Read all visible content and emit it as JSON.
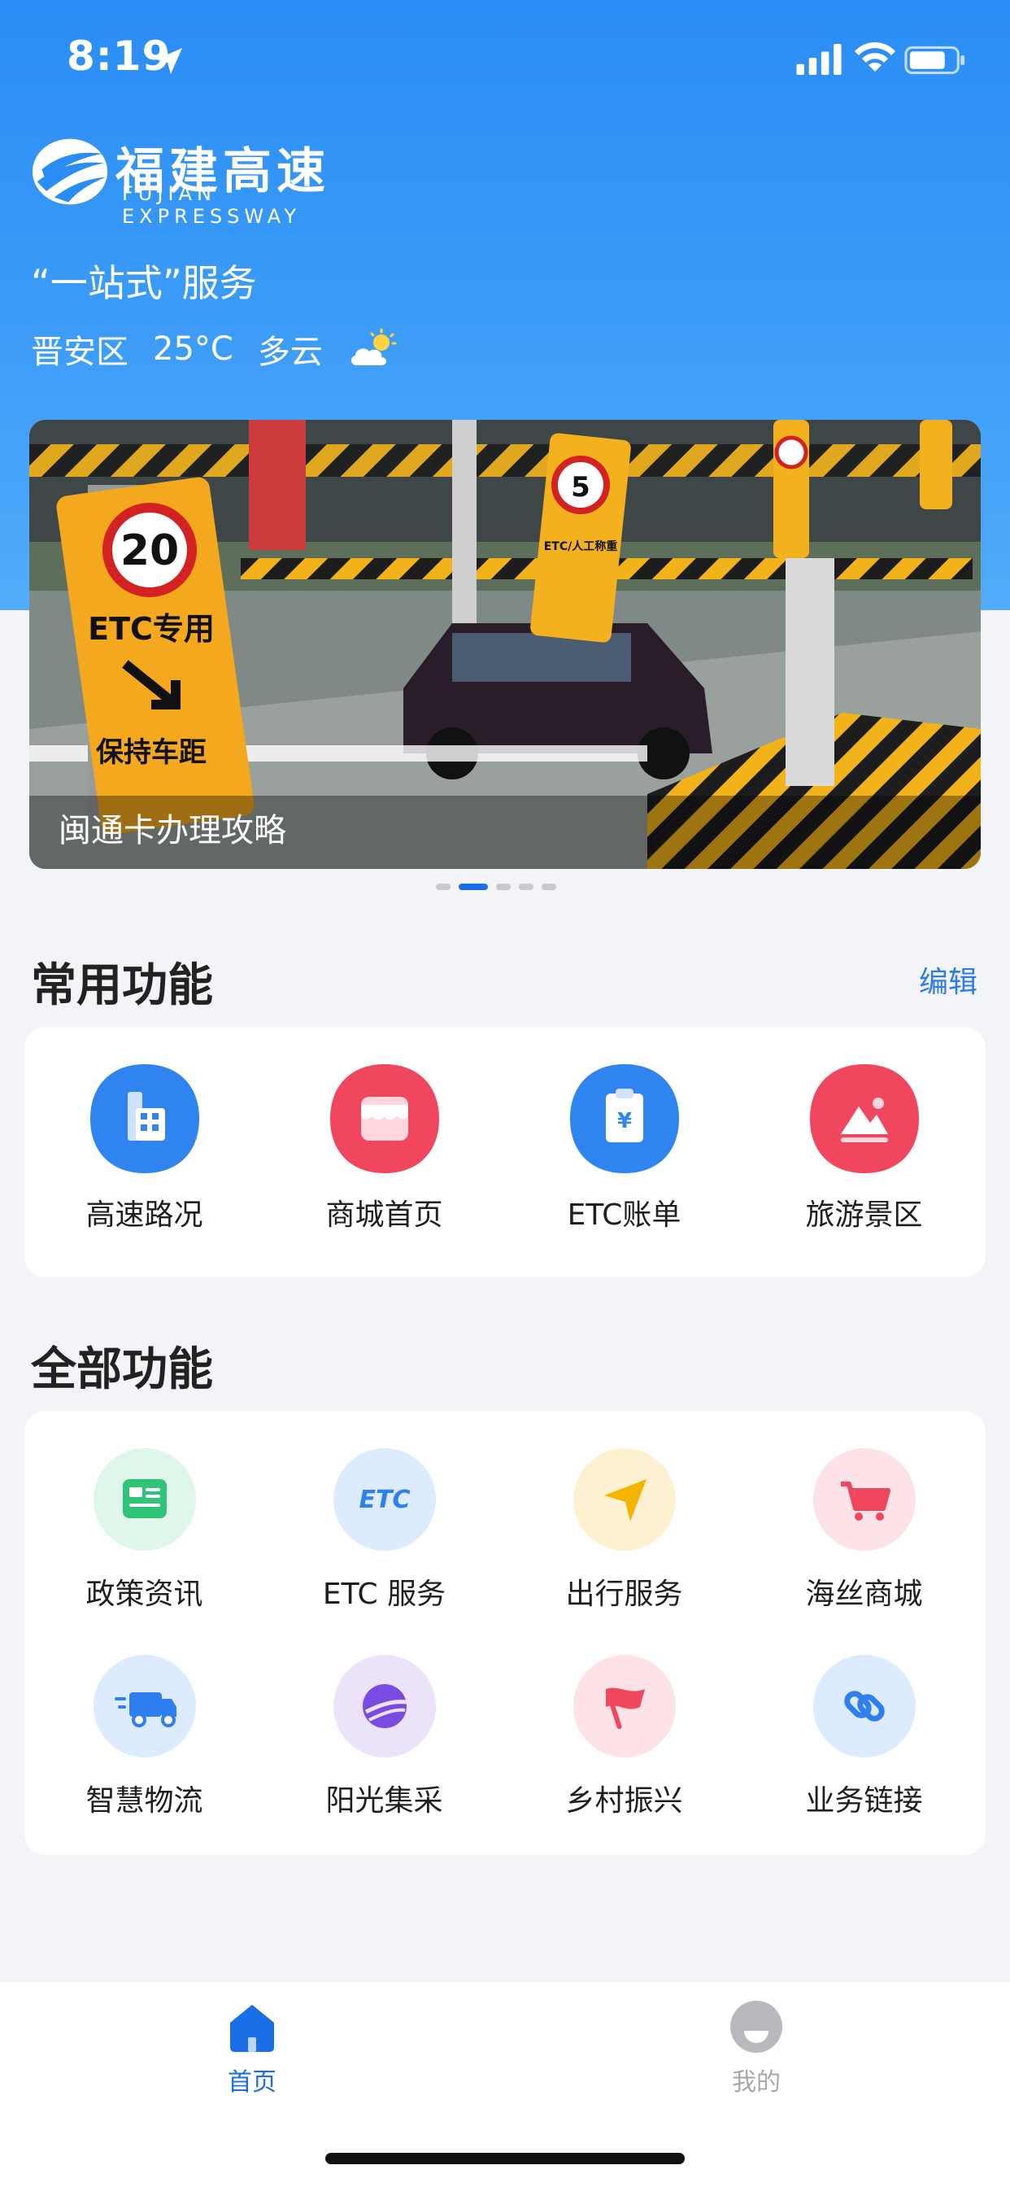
{
  "status_bar": {
    "time": "8:19"
  },
  "brand": {
    "name_cn": "福建高速",
    "name_en": "FUJIAN EXPRESSWAY"
  },
  "header": {
    "tagline": "“一站式”服务",
    "weather": {
      "district": "晋安区",
      "temperature": "25°C",
      "condition": "多云",
      "icon": "partly-cloudy-icon"
    }
  },
  "banner": {
    "caption": "闽通卡办理攻略",
    "sign_left_speed": "20",
    "sign_left_line1": "ETC专用",
    "sign_left_line2": "保持车距",
    "sign_mid_speed": "5",
    "sign_mid_text": "ETC/人工称重",
    "pagination": {
      "count": 5,
      "active_index": 1
    }
  },
  "common_functions": {
    "title": "常用功能",
    "edit_label": "编辑",
    "items": [
      {
        "label": "高速路况",
        "icon": "road-status-icon",
        "color": "#2f84f0"
      },
      {
        "label": "商城首页",
        "icon": "shop-icon",
        "color": "#f0475f"
      },
      {
        "label": "ETC账单",
        "icon": "bill-icon",
        "color": "#2f84f0"
      },
      {
        "label": "旅游景区",
        "icon": "scenic-icon",
        "color": "#f0475f"
      }
    ]
  },
  "all_functions": {
    "title": "全部功能",
    "items": [
      {
        "label": "政策资讯",
        "icon": "news-icon",
        "bg": "#dff6ea",
        "color": "#2fc47a"
      },
      {
        "label": "ETC 服务",
        "icon": "etc-icon",
        "icon_text": "ETC",
        "bg": "#dcebfd",
        "color": "#2f7ff0"
      },
      {
        "label": "出行服务",
        "icon": "navigation-icon",
        "bg": "#fdf1d2",
        "color": "#f5b400"
      },
      {
        "label": "海丝商城",
        "icon": "cart-icon",
        "bg": "#fde3e7",
        "color": "#f0475f"
      },
      {
        "label": "智慧物流",
        "icon": "truck-icon",
        "bg": "#dcebfd",
        "color": "#2f7ff0"
      },
      {
        "label": "阳光集采",
        "icon": "planet-icon",
        "bg": "#ece3fb",
        "color": "#7a4be0"
      },
      {
        "label": "乡村振兴",
        "icon": "flag-icon",
        "bg": "#fde3e7",
        "color": "#f0475f"
      },
      {
        "label": "业务链接",
        "icon": "link-icon",
        "bg": "#dcebfd",
        "color": "#2f7ff0"
      }
    ]
  },
  "tabbar": {
    "tabs": [
      {
        "label": "首页",
        "icon": "home-icon",
        "active": true,
        "color": "#1a6fe8"
      },
      {
        "label": "我的",
        "icon": "profile-icon",
        "active": false,
        "color": "#a9a9ad"
      }
    ]
  }
}
